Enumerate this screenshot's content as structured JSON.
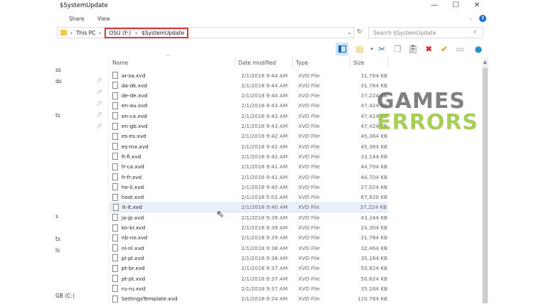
{
  "window": {
    "title": "$SystemUpdate"
  },
  "ribbon": {
    "tabs": [
      "Share",
      "View"
    ]
  },
  "address": {
    "segments": [
      "This PC",
      "OSU (F:)",
      "$SystemUpdate"
    ]
  },
  "search": {
    "placeholder": "Search $SystemUpdate"
  },
  "toolbar": {
    "icons": [
      "preview-pane-icon",
      "new-item-icon",
      "cut-icon",
      "copy-icon",
      "paste-icon",
      "delete-icon",
      "check-icon",
      "rename-icon",
      "globe-icon"
    ]
  },
  "columns": [
    "Name",
    "Date modified",
    "Type",
    "Size"
  ],
  "sidebar": {
    "items": [
      "ss",
      "ds",
      "ts",
      "s",
      "ts",
      "ls",
      "GB (C:)"
    ]
  },
  "files": [
    {
      "name": "ar-sa.xvd",
      "date": "2/1/2018 9:44 AM",
      "type": "XVD File",
      "size": "31,784 KB"
    },
    {
      "name": "da-dk.xvd",
      "date": "2/1/2018 9:44 AM",
      "type": "XVD File",
      "size": "31,784 KB"
    },
    {
      "name": "de-de.xvd",
      "date": "2/1/2018 9:44 AM",
      "type": "XVD File",
      "size": "37,224 KB"
    },
    {
      "name": "en-au.xvd",
      "date": "2/1/2018 9:43 AM",
      "type": "XVD File",
      "size": "47,424 KB"
    },
    {
      "name": "en-ca.xvd",
      "date": "2/1/2018 9:43 AM",
      "type": "XVD File",
      "size": "47,424 KB"
    },
    {
      "name": "en-gb.xvd",
      "date": "2/1/2018 9:43 AM",
      "type": "XVD File",
      "size": "47,424 KB"
    },
    {
      "name": "es-es.xvd",
      "date": "2/1/2018 9:42 AM",
      "type": "XVD File",
      "size": "45,384 KB"
    },
    {
      "name": "es-mx.xvd",
      "date": "2/1/2018 9:42 AM",
      "type": "XVD File",
      "size": "45,384 KB"
    },
    {
      "name": "fi-fi.xvd",
      "date": "2/1/2018 9:42 AM",
      "type": "XVD File",
      "size": "33,144 KB"
    },
    {
      "name": "fr-ca.xvd",
      "date": "2/1/2018 9:41 AM",
      "type": "XVD File",
      "size": "44,704 KB"
    },
    {
      "name": "fr-fr.xvd",
      "date": "2/1/2018 9:41 AM",
      "type": "XVD File",
      "size": "44,704 KB"
    },
    {
      "name": "he-il.xvd",
      "date": "2/1/2018 9:40 AM",
      "type": "XVD File",
      "size": "27,024 KB"
    },
    {
      "name": "host.xvd",
      "date": "2/1/2018 5:01 AM",
      "type": "XVD File",
      "size": "67,820 KB"
    },
    {
      "name": "it-it.xvd",
      "date": "2/1/2018 9:40 AM",
      "type": "XVD File",
      "size": "37,224 KB"
    },
    {
      "name": "ja-jp.xvd",
      "date": "2/1/2018 9:39 AM",
      "type": "XVD File",
      "size": "43,344 KB"
    },
    {
      "name": "ko-kr.xvd",
      "date": "2/1/2018 9:39 AM",
      "type": "XVD File",
      "size": "24,304 KB"
    },
    {
      "name": "nb-no.xvd",
      "date": "2/1/2018 9:39 AM",
      "type": "XVD File",
      "size": "31,784 KB"
    },
    {
      "name": "nl-nl.xvd",
      "date": "2/1/2018 9:38 AM",
      "type": "XVD File",
      "size": "32,464 KB"
    },
    {
      "name": "pl-pl.xvd",
      "date": "2/1/2018 9:38 AM",
      "type": "XVD File",
      "size": "35,184 KB"
    },
    {
      "name": "pt-br.xvd",
      "date": "2/1/2018 9:37 AM",
      "type": "XVD File",
      "size": "50,824 KB"
    },
    {
      "name": "pt-pt.xvd",
      "date": "2/1/2018 9:37 AM",
      "type": "XVD File",
      "size": "50,824 KB"
    },
    {
      "name": "ru-ru.xvd",
      "date": "2/1/2018 9:37 AM",
      "type": "XVD File",
      "size": "35,184 KB"
    },
    {
      "name": "SettingsTemplate.xvd",
      "date": "2/1/2018 9:24 AM",
      "type": "XVD File",
      "size": "120,784 KB"
    }
  ],
  "selected_index": 13,
  "watermark": {
    "line1": "GAMES",
    "line2": "ERRORS"
  },
  "colors": {
    "highlight": "#d9363e",
    "selection": "#e8f1fb",
    "watermark_gray": "#6b6b6b",
    "watermark_green": "#9bc53d"
  }
}
